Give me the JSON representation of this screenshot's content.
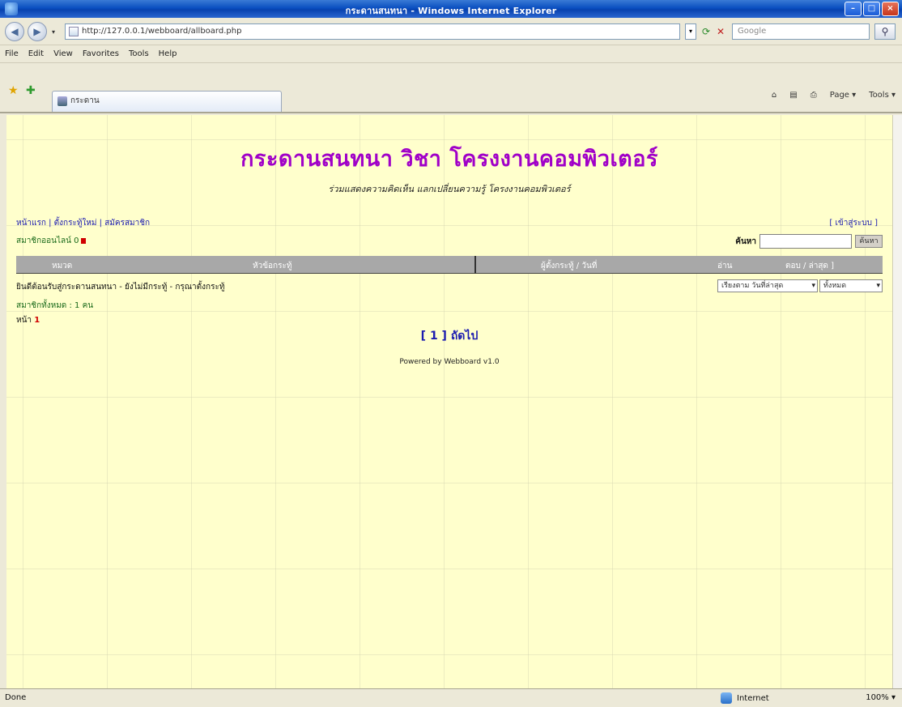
{
  "window": {
    "title": "กระดานสนทนา - Windows Internet Explorer",
    "minimize": "–",
    "maximize": "□",
    "close": "×"
  },
  "address": {
    "url": "http://127.0.0.1/webboard/allboard.php",
    "search_placeholder": "Google",
    "back_icon": "back-arrow",
    "forward_icon": "forward-arrow"
  },
  "menu": [
    "File",
    "Edit",
    "View",
    "Favorites",
    "Tools",
    "Help"
  ],
  "tabs": [
    {
      "label": "กระดาน"
    }
  ],
  "commandbar": {
    "home": "⌂",
    "feeds": "▤",
    "print": "⎙",
    "page": "Page ▾",
    "tools": "Tools ▾"
  },
  "page": {
    "heading": "กระดานสนทนา วิชา โครงงานคอมพิวเตอร์",
    "subheading": "ร่วมแสดงความคิดเห็น แลกเปลี่ยนความรู้ โครงงานคอมพิวเตอร์",
    "toplinks": "หน้าแรก | ตั้งกระทู้ใหม่ | สมัครสมาชิก",
    "member_info": "สมาชิกออนไลน์ 0",
    "login_link": "[ เข้าสู่ระบบ ]",
    "search_label": "ค้นหา",
    "search_button": "ค้นหา",
    "table_headers": {
      "topic": "หมวด",
      "title": "หัวข้อกระทู้",
      "author": "ผู้ตั้งกระทู้ / วันที่",
      "reads": "อ่าน",
      "replies": "ตอบ / ล่าสุด ]"
    },
    "row1_text": "ยินดีต้อนรับสู่กระดานสนทนา - ยังไม่มีกระทู้ - กรุณาตั้งกระทู้",
    "row1_dropdown_a": "เรียงตาม วันที่ล่าสุด",
    "row1_dropdown_b": "ทั้งหมด",
    "row2_text": "สมาชิกทั้งหมด : 1 คน",
    "row3_prefix": "หน้า",
    "row3_page": "1",
    "pager": "[ 1 ] ถัดไป",
    "footer_note": "Powered by Webboard v1.0"
  },
  "status": {
    "text": "Done",
    "zone": "Internet",
    "zoom": "100% ▾"
  },
  "colors": {
    "heading": "#a000c8",
    "content_bg": "#ffffcc",
    "header_bg": "#a8a8a8"
  }
}
